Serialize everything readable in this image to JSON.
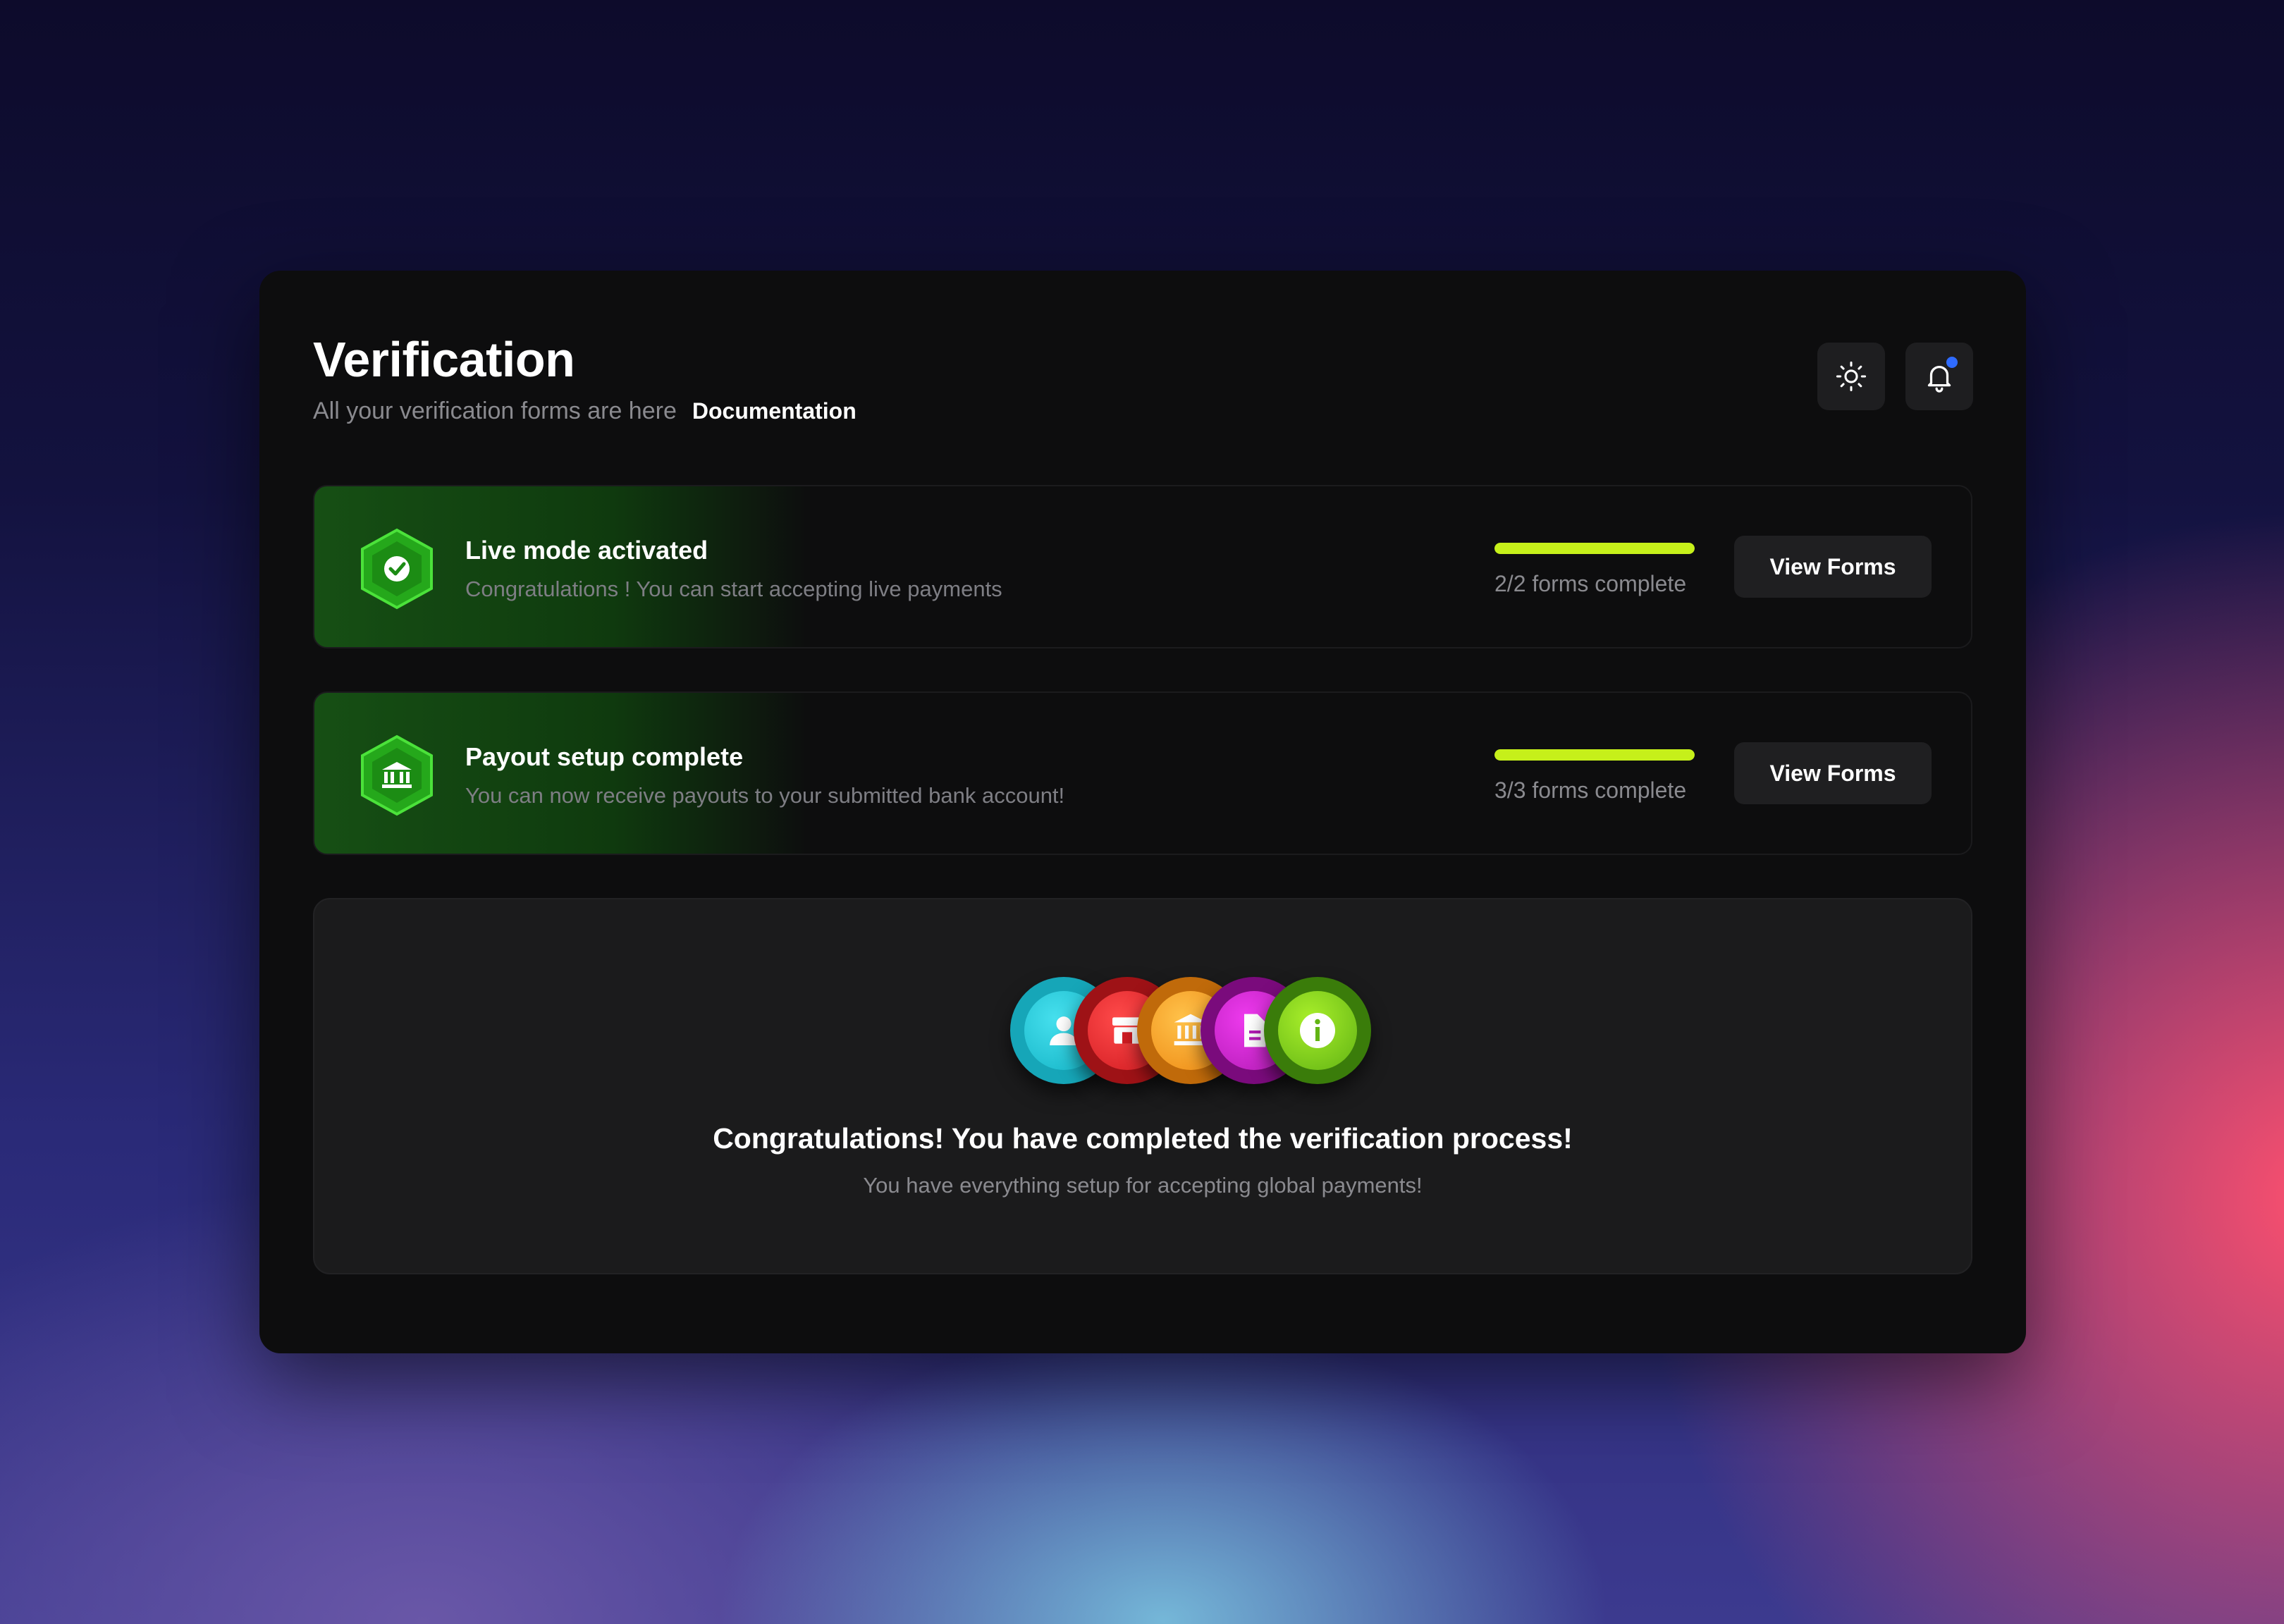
{
  "page": {
    "title": "Verification",
    "subtitle": "All your verification forms are here",
    "documentation_link": "Documentation"
  },
  "header_actions": [
    {
      "icon": "sun-icon",
      "label": "theme toggle"
    },
    {
      "icon": "bell-icon",
      "label": "notifications",
      "has_unread_dot": true
    }
  ],
  "statuses": [
    {
      "icon": "verified-badge-icon",
      "title": "Live mode activated",
      "description": "Congratulations ! You can start accepting live payments",
      "progress": 1.0,
      "progress_label": "2/2 forms complete",
      "button_label": "View Forms"
    },
    {
      "icon": "bank-icon",
      "title": "Payout setup complete",
      "description": "You can now receive payouts to your submitted bank account!",
      "progress": 1.0,
      "progress_label": "3/3 forms complete",
      "button_label": "View Forms"
    }
  ],
  "completion": {
    "badges": [
      "user-icon",
      "store-icon",
      "bank-icon",
      "document-icon",
      "info-icon"
    ],
    "title": "Congratulations! You have completed the verification process!",
    "subtitle": "You have everything setup for accepting global payments!"
  },
  "colors": {
    "accent_progress": "#c6f01a",
    "status_gradient": "#164f14",
    "notification_dot": "#2f6bff",
    "badge_colors": [
      "#14b4c6",
      "#d21c22",
      "#ee8a14",
      "#b41cb6",
      "#62b414"
    ]
  }
}
